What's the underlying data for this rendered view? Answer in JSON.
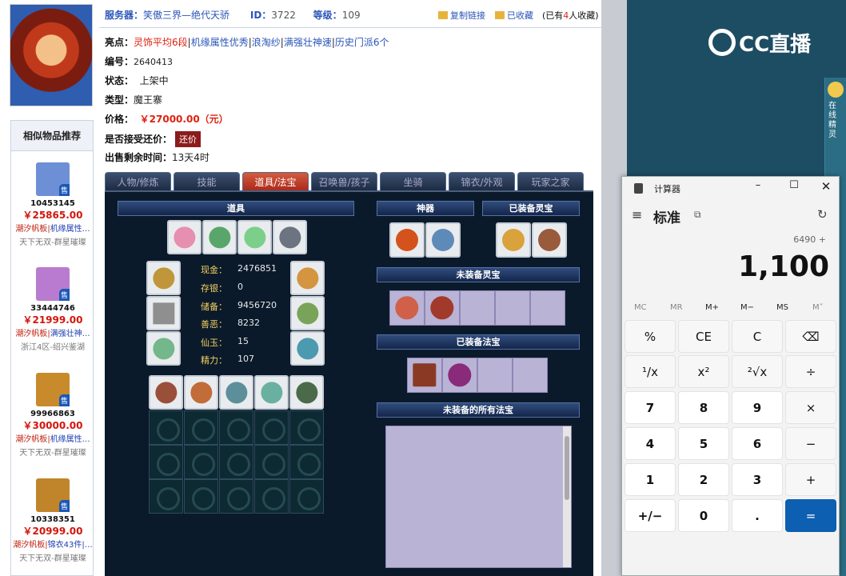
{
  "header": {
    "server_label": "服务器：",
    "server_value": "笑傲三界—绝代天骄",
    "id_label": "ID：",
    "id_value": "3722",
    "level_label": "等级：",
    "level_value": "109",
    "copy_link": "复制链接",
    "favorited": "已收藏",
    "fav_count_pre": "(已有",
    "fav_count": "4",
    "fav_count_post": "人收藏)"
  },
  "info": {
    "highlight_label": "亮点：",
    "highlights": [
      "灵饰平均6段",
      "机缘属性优秀",
      "浪淘纱",
      "满强壮神速",
      "历史门派6个"
    ],
    "number_label": "编号：",
    "number_value": "2640413",
    "status_label": "状态：",
    "status_value": "上架中",
    "type_label": "类型：",
    "type_value": "魔王寨",
    "price_label": "价格：",
    "price_value": "￥27000.00（元）",
    "bargain_label": "是否接受还价：",
    "bargain_button": "还价",
    "time_label": "出售剩余时间：",
    "time_value": "13天4时"
  },
  "similar": {
    "title": "相似物品推荐",
    "items": [
      {
        "id": "10453145",
        "price": "￥25865.00",
        "tag_red": "潮汐帆板",
        "tag_blue": "机缘属性…",
        "server": "天下无双-群星璀璨",
        "color": "#6d8fd6",
        "badge": "售"
      },
      {
        "id": "33444746",
        "price": "￥21999.00",
        "tag_red": "潮汐帆板",
        "tag_blue": "满强壮神…",
        "server": "浙江4区-绍兴鉴湖",
        "color": "#b97bd0",
        "badge": "售"
      },
      {
        "id": "99966863",
        "price": "￥30000.00",
        "tag_red": "潮汐帆板",
        "tag_blue": "机缘属性…",
        "server": "天下无双-群星璀璨",
        "color": "#c98a2c",
        "badge": "售"
      },
      {
        "id": "10338351",
        "price": "￥20999.00",
        "tag_red": "潮汐帆板",
        "tag_blue": "锦衣43件|…",
        "server": "天下无双-群星璀璨",
        "color": "#c0842b",
        "badge": "售"
      }
    ]
  },
  "tabs": [
    "人物/修炼",
    "技能",
    "道具/法宝",
    "召唤兽/孩子",
    "坐骑",
    "锦衣/外观",
    "玩家之家"
  ],
  "panel": {
    "props_bar": "道具",
    "shenqi_bar": "神器",
    "equipped_lingbao_bar": "已装备灵宝",
    "unequipped_lingbao_bar": "未装备灵宝",
    "equipped_fabao_bar": "已装备法宝",
    "all_fabao_bar": "未装备的所有法宝",
    "stats": [
      {
        "k": "现金：",
        "v": "2476851"
      },
      {
        "k": "存银：",
        "v": "0"
      },
      {
        "k": "储备：",
        "v": "9456720"
      },
      {
        "k": "善恶：",
        "v": "8232"
      },
      {
        "k": "仙玉：",
        "v": "15"
      },
      {
        "k": "精力：",
        "v": "107"
      }
    ]
  },
  "stream": {
    "logo": "CC直播",
    "side_text": "在线精灵"
  },
  "calculator": {
    "title": "计算器",
    "mode": "标准",
    "expression": "6490 +",
    "display": "1,100",
    "memory": [
      "MC",
      "MR",
      "M+",
      "M−",
      "MS",
      "M˅"
    ],
    "buttons": [
      "%",
      "CE",
      "C",
      "⌫",
      "¹/x",
      "x²",
      "²√x",
      "÷",
      "7",
      "8",
      "9",
      "×",
      "4",
      "5",
      "6",
      "−",
      "1",
      "2",
      "3",
      "+",
      "+/−",
      "0",
      ".",
      "="
    ]
  },
  "colors": {
    "accent_blue": "#2a55b8",
    "price_red": "#e0200f",
    "panel_bg": "#0b1a2b",
    "calc_equals": "#0d5fb1",
    "stream_bg": "#1d4d63"
  }
}
